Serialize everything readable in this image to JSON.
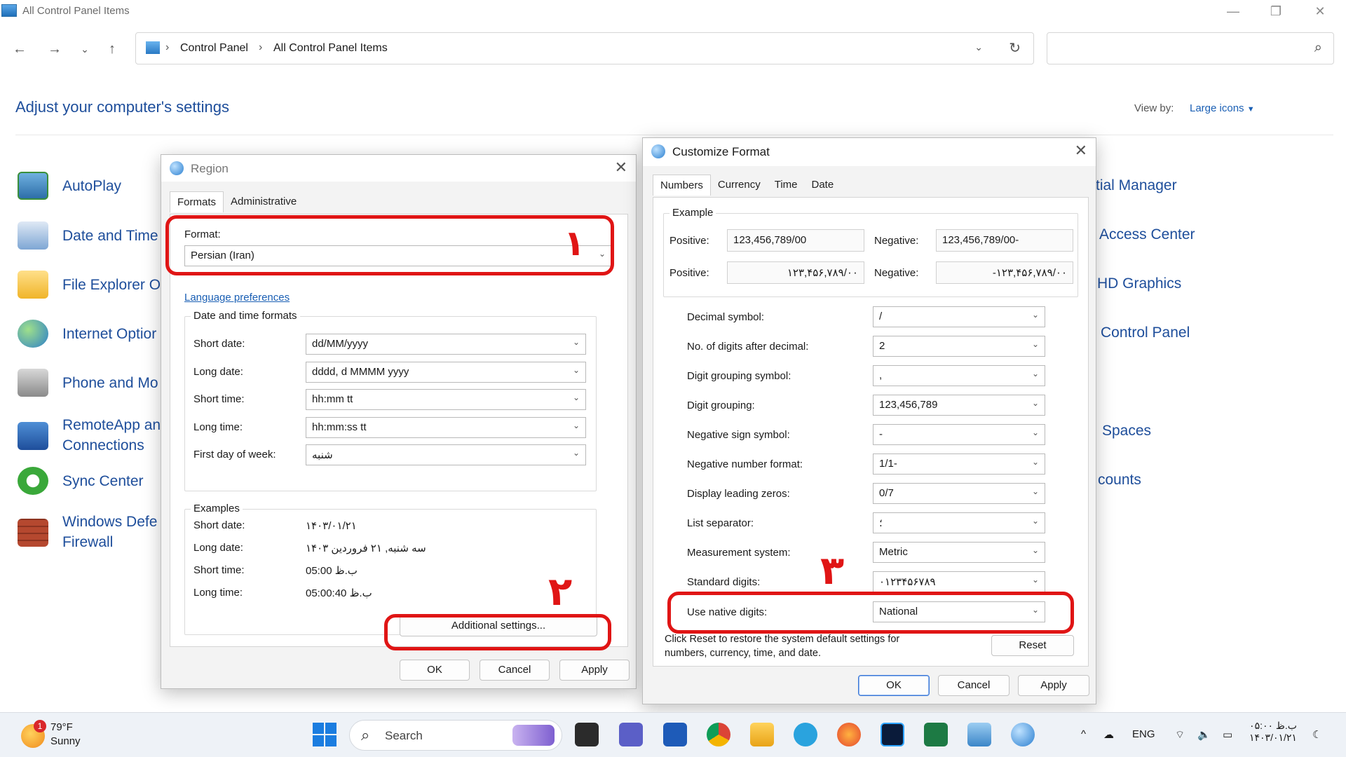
{
  "window": {
    "title": "All Control Panel Items"
  },
  "address": {
    "crumbs": [
      "Control Panel",
      "All Control Panel Items"
    ]
  },
  "heading": "Adjust your computer's settings",
  "viewby": {
    "label": "View by:",
    "value": "Large icons"
  },
  "left_items": [
    {
      "label": "AutoPlay",
      "icon": "autoplay-icon"
    },
    {
      "label": "Date and Time",
      "icon": "date-time-icon"
    },
    {
      "label": "File Explorer O",
      "icon": "file-explorer-options-icon"
    },
    {
      "label": "Internet Optior",
      "icon": "internet-options-icon"
    },
    {
      "label": "Phone and Mo",
      "icon": "phone-modem-icon"
    },
    {
      "label": "RemoteApp an\nConnections",
      "icon": "remoteapp-icon"
    },
    {
      "label": "Sync Center",
      "icon": "sync-center-icon"
    },
    {
      "label": "Windows Defe\nFirewall",
      "icon": "firewall-icon"
    }
  ],
  "right_items": [
    "tial Manager",
    "Access Center",
    "HD Graphics",
    "Control Panel",
    "Spaces",
    "counts"
  ],
  "region": {
    "title": "Region",
    "tabs": [
      "Formats",
      "Administrative"
    ],
    "format_label": "Format:",
    "format_value": "Persian (Iran)",
    "language_link": "Language preferences",
    "dt_group": "Date and time formats",
    "fields": [
      {
        "label": "Short date:",
        "value": "dd/MM/yyyy"
      },
      {
        "label": "Long date:",
        "value": "dddd, d MMMM yyyy"
      },
      {
        "label": "Short time:",
        "value": "hh:mm tt"
      },
      {
        "label": "Long time:",
        "value": "hh:mm:ss tt"
      },
      {
        "label": "First day of week:",
        "value": "شنبه"
      }
    ],
    "examples_group": "Examples",
    "examples": [
      {
        "label": "Short date:",
        "value": "۱۴۰۳/۰۱/۲۱"
      },
      {
        "label": "Long date:",
        "value": "سه شنبه, ۲۱ فروردین ۱۴۰۳"
      },
      {
        "label": "Short time:",
        "value": "05:00 ب.ظ"
      },
      {
        "label": "Long time:",
        "value": "05:00:40 ب.ظ"
      }
    ],
    "additional": "Additional settings...",
    "ok": "OK",
    "cancel": "Cancel",
    "apply": "Apply"
  },
  "customize": {
    "title": "Customize Format",
    "tabs": [
      "Numbers",
      "Currency",
      "Time",
      "Date"
    ],
    "example_group": "Example",
    "positive_label": "Positive:",
    "negative_label": "Negative:",
    "pos1": "123,456,789/00",
    "neg1": "123,456,789/00-",
    "pos2": "۱۲۳,۴۵۶,۷۸۹/۰۰",
    "neg2": "-۱۲۳,۴۵۶,۷۸۹/۰۰",
    "fields": [
      {
        "label": "Decimal symbol:",
        "value": "/"
      },
      {
        "label": "No. of digits after decimal:",
        "value": "2"
      },
      {
        "label": "Digit grouping symbol:",
        "value": ","
      },
      {
        "label": "Digit grouping:",
        "value": "123,456,789"
      },
      {
        "label": "Negative sign symbol:",
        "value": "-"
      },
      {
        "label": "Negative number format:",
        "value": "1/1-"
      },
      {
        "label": "Display leading zeros:",
        "value": "0/7"
      },
      {
        "label": "List separator:",
        "value": "؛"
      },
      {
        "label": "Measurement system:",
        "value": "Metric"
      },
      {
        "label": "Standard digits:",
        "value": "۰۱۲۳۴۵۶۷۸۹"
      },
      {
        "label": "Use native digits:",
        "value": "National"
      }
    ],
    "reset_note": "Click Reset to restore the system default settings for numbers, currency, time, and date.",
    "reset": "Reset",
    "ok": "OK",
    "cancel": "Cancel",
    "apply": "Apply"
  },
  "annotations": [
    "۱",
    "۲",
    "۳"
  ],
  "taskbar": {
    "weather_badge": "1",
    "temp": "79°F",
    "condition": "Sunny",
    "search": "Search",
    "lang": "ENG",
    "time": "۰۵:۰۰ ب.ظ",
    "date": "۱۴۰۳/۰۱/۲۱"
  },
  "colors": {
    "accent": "#1e4e9b",
    "annotation": "#e01515",
    "link": "#1a5fb4"
  }
}
